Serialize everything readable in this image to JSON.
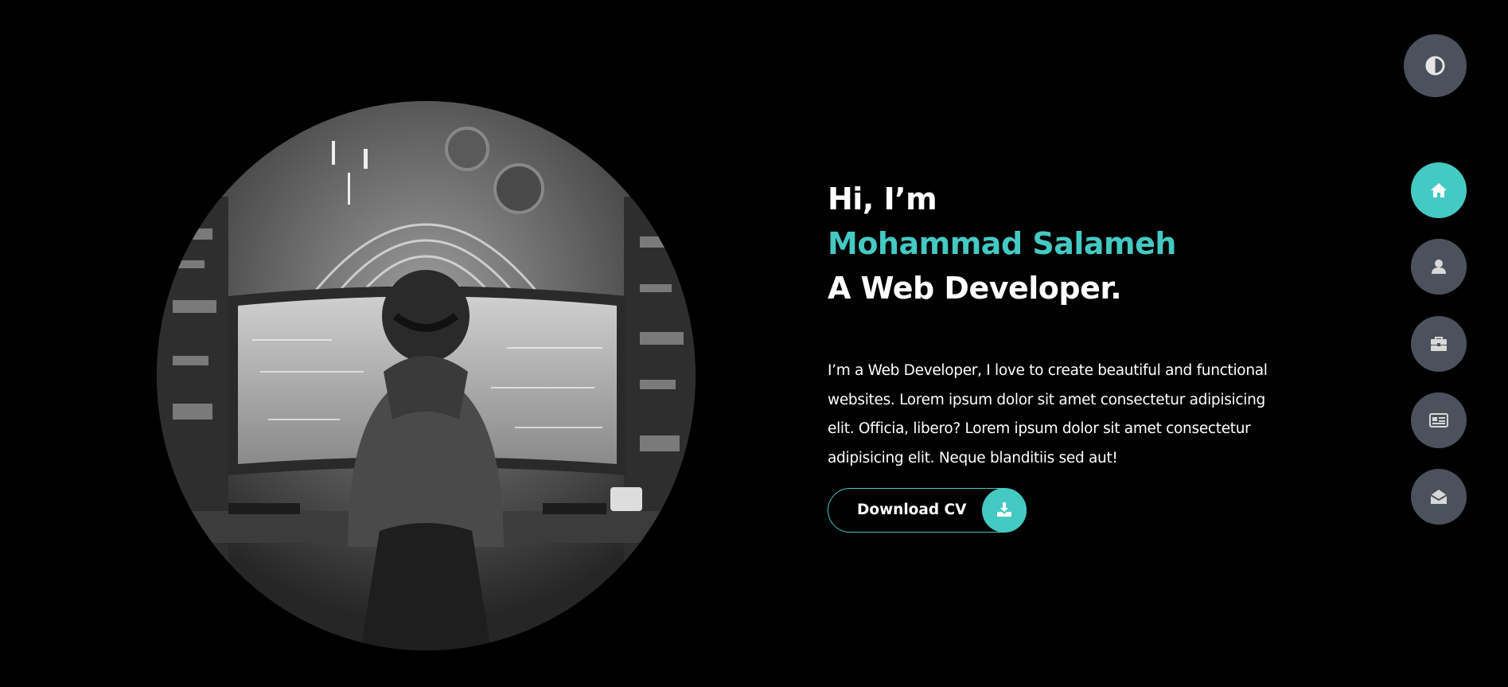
{
  "hero": {
    "greeting": "Hi, I’m",
    "name": "Mohammad Salameh",
    "role": "A Web Developer.",
    "bio": "I’m a Web Developer, I love to create beautiful and functional websites. Lorem ipsum dolor sit amet consectetur adipisicing elit. Officia, libero? Lorem ipsum dolor sit amet consectetur adipisicing elit. Neque blanditiis sed aut!",
    "cv_button_label": "Download CV",
    "cv_icon": "download-icon"
  },
  "theme_toggle": {
    "icon": "contrast-icon"
  },
  "nav": {
    "items": [
      {
        "id": "home",
        "icon": "home-icon",
        "active": true
      },
      {
        "id": "about",
        "icon": "user-icon",
        "active": false
      },
      {
        "id": "portfolio",
        "icon": "briefcase-icon",
        "active": false
      },
      {
        "id": "blog",
        "icon": "newspaper-icon",
        "active": false
      },
      {
        "id": "contact",
        "icon": "envelope-open-icon",
        "active": false
      }
    ]
  },
  "colors": {
    "accent": "#45c9c3",
    "background": "#000000",
    "nav_button": "#4b525d",
    "text": "#ffffff"
  }
}
